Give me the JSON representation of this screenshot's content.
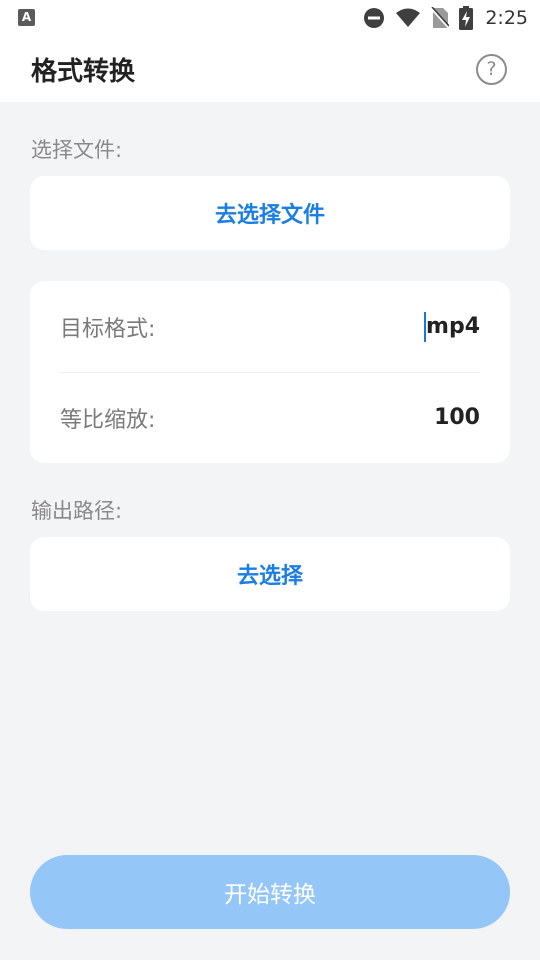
{
  "status_bar": {
    "left_icon": "A",
    "time": "2:25",
    "icons": [
      "dnd-icon",
      "wifi-icon",
      "no-sim-icon",
      "battery-charging-icon"
    ]
  },
  "app_bar": {
    "title": "格式转换",
    "help_icon_text": "?"
  },
  "select_file": {
    "label": "选择文件:",
    "button": "去选择文件"
  },
  "settings": {
    "format_label": "目标格式:",
    "format_value": "mp4",
    "scale_label": "等比缩放:",
    "scale_value": "100"
  },
  "output": {
    "label": "输出路径:",
    "button": "去选择"
  },
  "start_button": "开始转换",
  "colors": {
    "accent": "#1a7ee3",
    "start_button_bg": "#94c6f7",
    "page_bg": "#f3f4f6"
  }
}
